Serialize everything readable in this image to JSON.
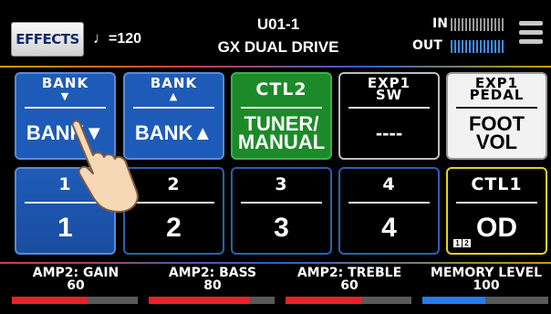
{
  "header": {
    "effects_label": "EFFECTS",
    "tempo_symbol": "♩",
    "tempo_value": "=120",
    "patch_number": "U01-1",
    "patch_name": "GX DUAL DRIVE",
    "in_label": "IN",
    "out_label": "OUT",
    "menu_icon": "hamburger-menu-icon"
  },
  "tiles_row1": [
    {
      "top_line1": "BANK",
      "top_line2": "▼",
      "bottom": "BANK▼",
      "style": "blue"
    },
    {
      "top_line1": "BANK",
      "top_line2": "▲",
      "bottom": "BANK▲",
      "style": "blue"
    },
    {
      "top_line1": "CTL2",
      "top_line2": "",
      "bottom_line1": "TUNER/",
      "bottom_line2": "MANUAL",
      "style": "green"
    },
    {
      "top_line1": "EXP1",
      "top_line2": "SW",
      "bottom": "----",
      "style": "dark"
    },
    {
      "top_line1": "EXP1",
      "top_line2": "PEDAL",
      "bottom_line1": "FOOT",
      "bottom_line2": "VOL",
      "style": "white"
    }
  ],
  "tiles_row2": [
    {
      "top": "1",
      "bottom": "1",
      "style": "selected"
    },
    {
      "top": "2",
      "bottom": "2",
      "style": "outline-blue"
    },
    {
      "top": "3",
      "bottom": "3",
      "style": "outline-blue"
    },
    {
      "top": "4",
      "bottom": "4",
      "style": "outline-blue"
    },
    {
      "top": "CTL1",
      "bottom": "OD",
      "style": "yellow",
      "badge": [
        "1",
        "2"
      ]
    }
  ],
  "knobs": [
    {
      "label": "AMP2: GAIN",
      "value": "60",
      "level": 0.6,
      "color": "#e8222a"
    },
    {
      "label": "AMP2: BASS",
      "value": "80",
      "level": 0.8,
      "color": "#e8222a"
    },
    {
      "label": "AMP2: TREBLE",
      "value": "60",
      "level": 0.6,
      "color": "#e8222a"
    },
    {
      "label": "MEMORY LEVEL",
      "value": "100",
      "level": 0.5,
      "color": "#2a7ae8"
    }
  ],
  "colors": {
    "tile_blue": "#1e5bb8",
    "tile_green": "#1d8a2a",
    "ctl1_border": "#e6d21e",
    "knob_red": "#e8222a",
    "knob_blue": "#2a7ae8"
  }
}
